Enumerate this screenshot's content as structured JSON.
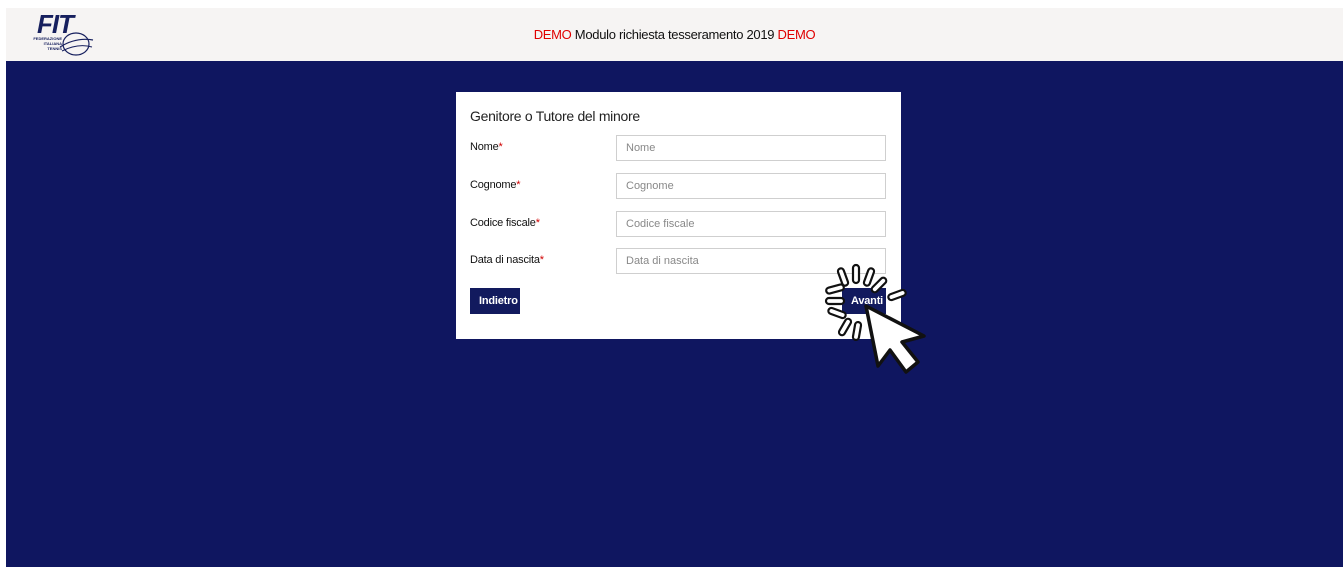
{
  "header": {
    "logo_text": "FIT",
    "logo_subtext": [
      "FEDERAZIONE",
      "ITALIANA",
      "TENNIS"
    ],
    "title_prefix": "DEMO",
    "title_main": " Modulo richiesta tesseramento 2019 ",
    "title_suffix": "DEMO"
  },
  "form": {
    "title": "Genitore o Tutore del minore",
    "fields": [
      {
        "label": "Nome",
        "required_mark": "*",
        "placeholder": "Nome",
        "value": ""
      },
      {
        "label": "Cognome",
        "required_mark": "*",
        "placeholder": "Cognome",
        "value": ""
      },
      {
        "label": "Codice fiscale",
        "required_mark": "*",
        "placeholder": "Codice fiscale",
        "value": ""
      },
      {
        "label": "Data di nascita",
        "required_mark": "*",
        "placeholder": "Data di nascita",
        "value": ""
      }
    ],
    "back_button": "Indietro",
    "next_button": "Avanti"
  },
  "colors": {
    "background": "#0f1660",
    "header_bg": "#f6f4f3",
    "button_bg": "#121a5e",
    "demo_red": "#e00000",
    "required_red": "#d00000"
  },
  "icons": {
    "logo": "fit-logo-icon",
    "cursor": "click-cursor-icon"
  }
}
